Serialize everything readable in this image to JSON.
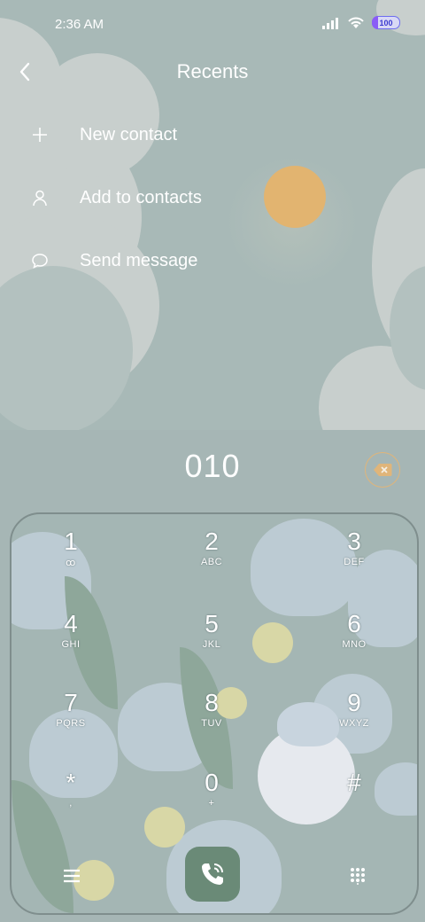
{
  "status_bar": {
    "time": "2:36 AM",
    "battery": "100"
  },
  "header": {
    "title": "Recents",
    "back_icon": "chevron-left-icon"
  },
  "menu": [
    {
      "label": "New contact",
      "icon": "plus-icon"
    },
    {
      "label": "Add to contacts",
      "icon": "person-icon"
    },
    {
      "label": "Send message",
      "icon": "chat-bubble-icon"
    }
  ],
  "dialer": {
    "number": "010"
  },
  "keys": [
    {
      "digit": "1",
      "letters": "ꝏ"
    },
    {
      "digit": "2",
      "letters": "ABC"
    },
    {
      "digit": "3",
      "letters": "DEF"
    },
    {
      "digit": "4",
      "letters": "GHI"
    },
    {
      "digit": "5",
      "letters": "JKL"
    },
    {
      "digit": "6",
      "letters": "MNO"
    },
    {
      "digit": "7",
      "letters": "PQRS"
    },
    {
      "digit": "8",
      "letters": "TUV"
    },
    {
      "digit": "9",
      "letters": "WXYZ"
    },
    {
      "digit": "*",
      "letters": ","
    },
    {
      "digit": "0",
      "letters": "+"
    },
    {
      "digit": "#",
      "letters": ""
    }
  ],
  "colors": {
    "accent_call": "#6a8a77",
    "sun": "#e2b470",
    "background": "#a6b6b5"
  }
}
